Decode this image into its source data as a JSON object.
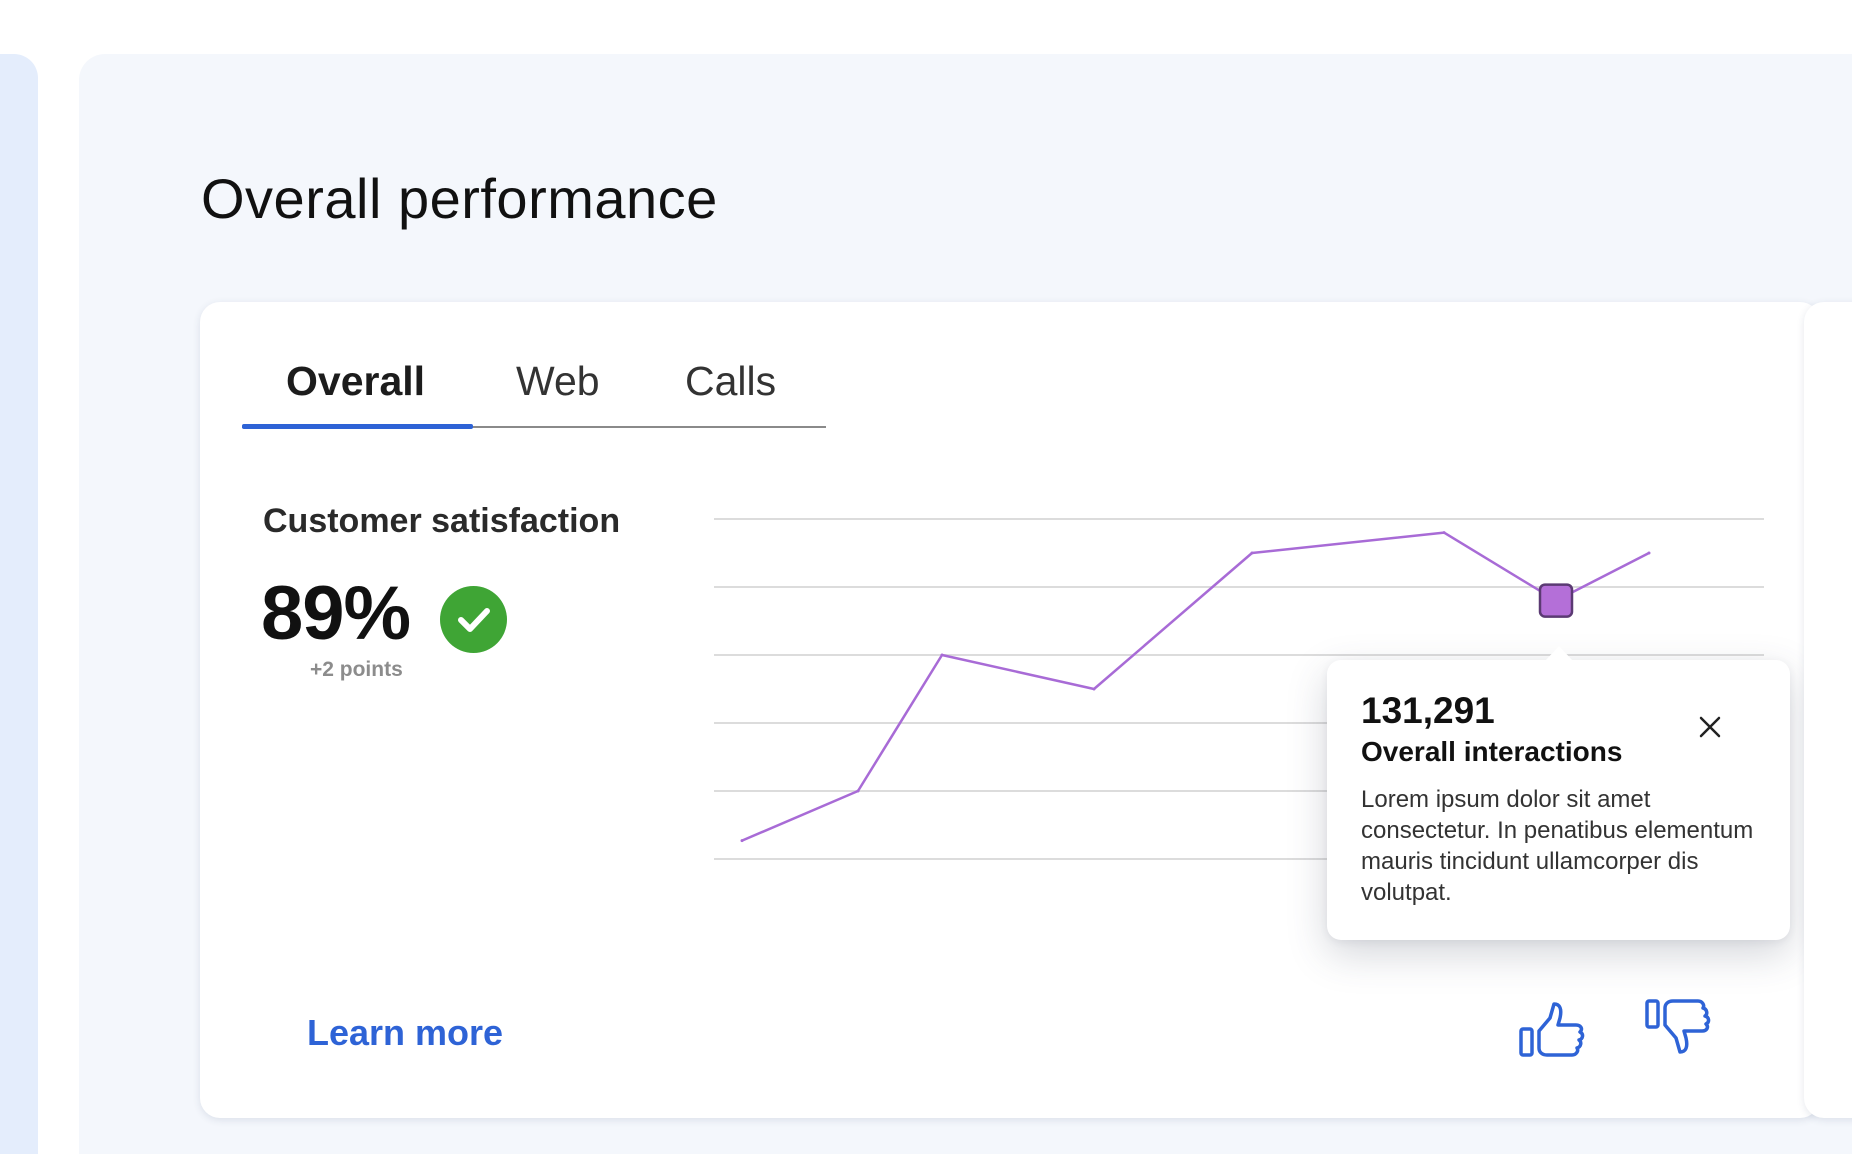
{
  "page": {
    "title": "Overall performance"
  },
  "tabs": [
    {
      "label": "Overall",
      "active": true
    },
    {
      "label": "Web",
      "active": false
    },
    {
      "label": "Calls",
      "active": false
    }
  ],
  "metric": {
    "label": "Customer satisfaction",
    "value": "89%",
    "change": "+2 points",
    "status_icon": "check-circle-icon",
    "status_color": "#3fa535"
  },
  "tooltip": {
    "value": "131,291",
    "title": "Overall interactions",
    "body": "Lorem ipsum dolor sit amet consectetur. In penatibus elementum mauris tincidunt ullamcorper dis volutpat.",
    "close_icon": "close-icon"
  },
  "footer": {
    "link_label": "Learn more",
    "like_icon": "thumbs-up-icon",
    "dislike_icon": "thumbs-down-icon"
  },
  "chart_data": {
    "type": "line",
    "title": "",
    "xlabel": "",
    "ylabel": "",
    "ylim": [
      0,
      5
    ],
    "grid": true,
    "gridlines": 6,
    "series": [
      {
        "values": [
          0.27,
          1.0,
          3.0,
          2.5,
          4.5,
          4.8,
          3.8,
          4.5
        ],
        "color": "#a86bd6",
        "highlight_index": 6
      }
    ]
  },
  "colors": {
    "accent": "#2e63d6",
    "line": "#a86bd6",
    "marker": "#b46fd8"
  }
}
